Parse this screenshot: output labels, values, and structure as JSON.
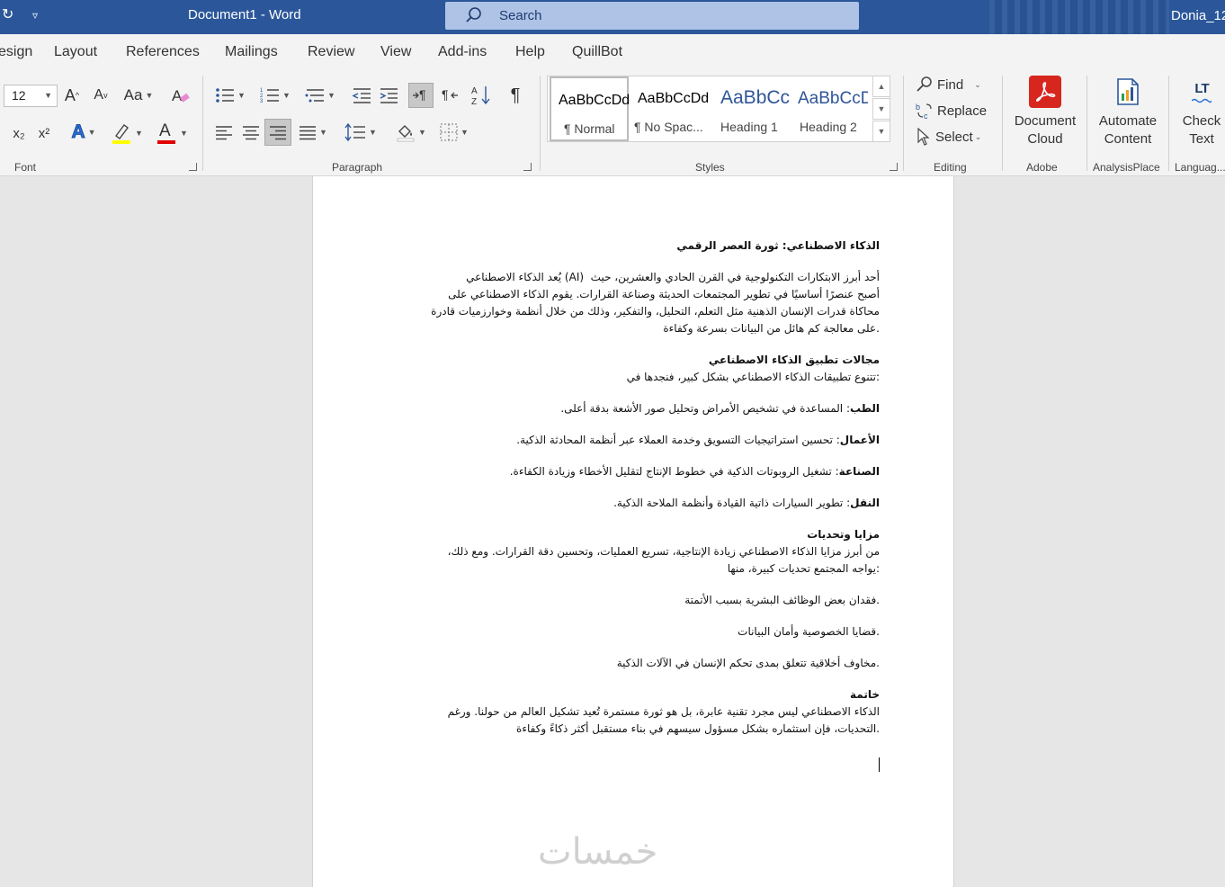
{
  "titlebar": {
    "document_title": "Document1  -  Word",
    "search_placeholder": "Search",
    "user_name": "Donia_12"
  },
  "tabs": [
    "esign",
    "Layout",
    "References",
    "Mailings",
    "Review",
    "View",
    "Add-ins",
    "Help",
    "QuillBot"
  ],
  "ribbon": {
    "font": {
      "size": "12",
      "label": "Font",
      "grow_label": "A",
      "shrink_label": "A",
      "case_label": "Aa",
      "subscript": "x₂",
      "superscript": "x²",
      "text_effects_label": "A",
      "font_color_label": "A",
      "highlight_color": "#ffff00",
      "font_color": "#e00000"
    },
    "paragraph": {
      "label": "Paragraph"
    },
    "styles": {
      "label": "Styles",
      "items": [
        {
          "sample": "AaBbCcDd",
          "name": "¶ Normal"
        },
        {
          "sample": "AaBbCcDd",
          "name": "¶ No Spac..."
        },
        {
          "sample": "AaBbCc",
          "name": "Heading 1"
        },
        {
          "sample": "AaBbCcD",
          "name": "Heading 2"
        }
      ]
    },
    "editing": {
      "label": "Editing",
      "find": "Find",
      "replace": "Replace",
      "select": "Select"
    },
    "adobe": {
      "label": "Adobe",
      "button_line1": "Document",
      "button_line2": "Cloud"
    },
    "analysisplace": {
      "label": "AnalysisPlace",
      "button_line1": "Automate",
      "button_line2": "Content"
    },
    "language": {
      "label": "Languag...",
      "button_line1": "Check",
      "button_line2": "Text",
      "icon_text": "LT"
    }
  },
  "document": {
    "title": "الذكاء الاصطناعي: ثورة العصر الرقمي",
    "intro_lines": [
      "أحد أبرز الابتكارات التكنولوجية في القرن الحادي والعشرين، حيث  (AI) يُعد الذكاء الاصطناعي",
      "أصبح عنصرًا أساسيًا في تطوير المجتمعات الحديثة وصناعة القرارات. يقوم الذكاء الاصطناعي على",
      "محاكاة قدرات الإنسان الذهنية مثل التعلم، التحليل، والتفكير، وذلك من خلال أنظمة وخوارزميات قادرة",
      ".على معالجة كم هائل من البيانات بسرعة وكفاءة"
    ],
    "fields_heading": "مجالات تطبيق الذكاء الاصطناعي",
    "fields_intro": ":تتنوع تطبيقات الذكاء الاصطناعي بشكل كبير، فنجدها في",
    "fields": [
      {
        "term": "الطب",
        "text": ": المساعدة في تشخيص الأمراض وتحليل صور الأشعة بدقة أعلى."
      },
      {
        "term": "الأعمال",
        "text": ": تحسين استراتيجيات التسويق وخدمة العملاء عبر أنظمة المحادثة الذكية."
      },
      {
        "term": "الصناعة",
        "text": ": تشغيل الروبوتات الذكية في خطوط الإنتاج لتقليل الأخطاء وزيادة الكفاءة."
      },
      {
        "term": "النقل",
        "text": ": تطوير السيارات ذاتية القيادة وأنظمة الملاحة الذكية."
      }
    ],
    "pros_heading": "مزايا وتحديات",
    "pros_lines": [
      "من أبرز مزايا الذكاء الاصطناعي زيادة الإنتاجية، تسريع العمليات، وتحسين دقة القرارات. ومع ذلك،",
      ":يواجه المجتمع تحديات كبيرة، منها"
    ],
    "challenges": [
      ".فقدان بعض الوظائف البشرية بسبب الأتمتة",
      ".قضايا الخصوصية وأمان البيانات",
      ".مخاوف أخلاقية تتعلق بمدى تحكم الإنسان في الآلات الذكية"
    ],
    "conclusion_heading": "خاتمة",
    "conclusion_lines": [
      "الذكاء الاصطناعي ليس مجرد تقنية عابرة، بل هو ثورة مستمرة تُعيد تشكيل العالم من حولنا. ورغم",
      ".التحديات، فإن استثماره بشكل مسؤول سيسهم في بناء مستقبل أكثر ذكاءً وكفاءة"
    ]
  },
  "watermark": "خمسات"
}
